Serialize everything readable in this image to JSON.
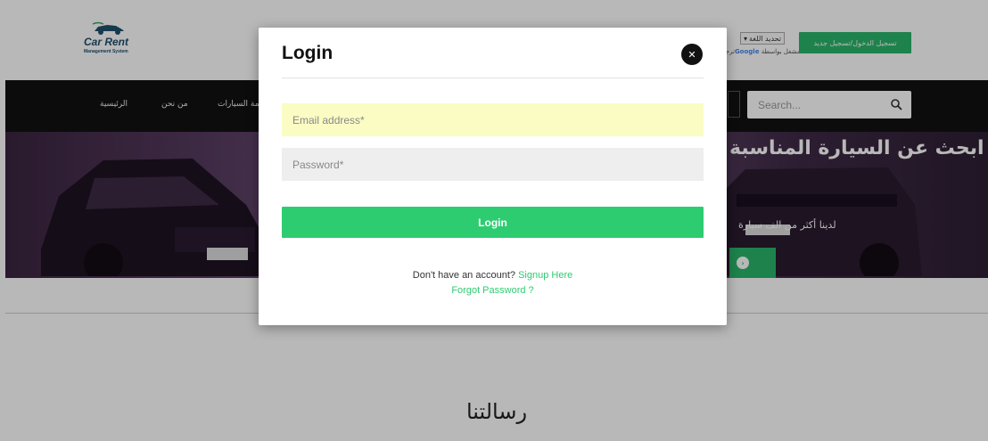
{
  "colors": {
    "accent": "#2ecc71",
    "register": "#2ab56a",
    "navbar": "#111111",
    "email_field_bg": "#fbfcc4",
    "password_field_bg": "#eeeeee"
  },
  "header": {
    "logo_title": "Car Rent",
    "logo_subtitle": "Management System",
    "language_select": "تحديد اللغة",
    "language_caption_prefix": "مشغل بواسطة",
    "language_caption_brand": "Google",
    "language_caption_suffix": "ترجمة",
    "register_button": "تسجيل الدخول/تسجيل جديد"
  },
  "nav": {
    "items": [
      "الرئيسية",
      "من نحن",
      "قائمة السيارات"
    ],
    "search_placeholder": "Search...",
    "search_icon": "search-icon"
  },
  "hero": {
    "headline": "ابحث عن السيارة المناسبة",
    "subline": "لدينا أكثر من الف سيارة"
  },
  "section": {
    "title": "رسالتنا"
  },
  "modal": {
    "title": "Login",
    "close_icon": "close-icon",
    "email_placeholder": "Email address*",
    "email_value": "",
    "password_placeholder": "Password*",
    "password_value": "",
    "login_button": "Login",
    "no_account_text": "Don't have an account?",
    "signup_link": "Signup Here",
    "forgot_link": "Forgot Password ?"
  }
}
